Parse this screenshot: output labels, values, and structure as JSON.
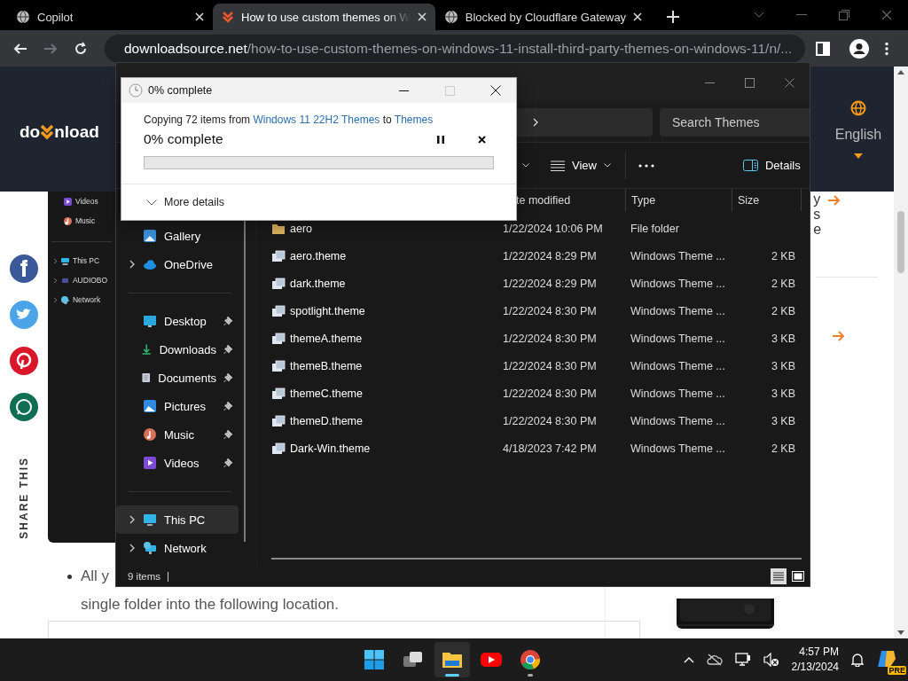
{
  "browser": {
    "tabs": [
      {
        "title": "Copilot",
        "kind": "globe",
        "selected": false
      },
      {
        "title": "How to use custom themes on W",
        "kind": "site",
        "selected": true
      },
      {
        "title": "Blocked by Cloudflare Gateway",
        "kind": "globe",
        "selected": false
      }
    ],
    "nav_buttons": [
      {
        "kind": "back",
        "disabled": false
      },
      {
        "kind": "forward",
        "disabled": true
      },
      {
        "kind": "reload",
        "disabled": false
      }
    ],
    "url": {
      "domain": "downloadsource.net",
      "path": "/how-to-use-custom-themes-on-windows-11-install-third-party-themes-on-windows-11/n/..."
    }
  },
  "page": {
    "logo": {
      "start": "do",
      "end": "nload"
    },
    "language": "English",
    "share_label": "SHARE THIS",
    "share_buttons": [
      {
        "kind": "facebook"
      },
      {
        "kind": "twitter"
      },
      {
        "kind": "pinterest"
      },
      {
        "kind": "whatsapp"
      }
    ],
    "embedded_screenshot": {
      "items": [
        {
          "label": "Videos",
          "kind": "videos",
          "expandable": false
        },
        {
          "label": "Music",
          "kind": "music",
          "expandable": false
        },
        {
          "label": "This PC",
          "kind": "pc",
          "expandable": true
        },
        {
          "label": "AUDIOBO",
          "kind": "drive",
          "expandable": true
        },
        {
          "label": "Network",
          "kind": "network",
          "expandable": true
        }
      ]
    },
    "bullet_lines": [
      "All y",
      "single folder into the following location."
    ],
    "right_fragments": [
      "y",
      "s",
      "e"
    ]
  },
  "explorer": {
    "search_placeholder": "Search Themes",
    "view_label": "View",
    "details_label": "Details",
    "columns": [
      "te modified",
      "Type",
      "Size"
    ],
    "sidebar": [
      {
        "label": "Gallery",
        "kind": "gallery",
        "expandable": false,
        "pinned": false,
        "selected": false
      },
      {
        "label": "OneDrive",
        "kind": "onedrive",
        "expandable": true,
        "pinned": false,
        "selected": false
      },
      {
        "kind": "divider"
      },
      {
        "label": "Desktop",
        "kind": "desktop",
        "expandable": false,
        "pinned": true,
        "selected": false
      },
      {
        "label": "Downloads",
        "kind": "downloads",
        "expandable": false,
        "pinned": true,
        "selected": false
      },
      {
        "label": "Documents",
        "kind": "documents",
        "expandable": false,
        "pinned": true,
        "selected": false
      },
      {
        "label": "Pictures",
        "kind": "pictures",
        "expandable": false,
        "pinned": true,
        "selected": false
      },
      {
        "label": "Music",
        "kind": "music",
        "expandable": false,
        "pinned": true,
        "selected": false
      },
      {
        "label": "Videos",
        "kind": "videos",
        "expandable": false,
        "pinned": true,
        "selected": false
      },
      {
        "kind": "divider"
      },
      {
        "label": "This PC",
        "kind": "pc",
        "expandable": true,
        "pinned": false,
        "selected": true
      },
      {
        "label": "Network",
        "kind": "network",
        "expandable": true,
        "pinned": false,
        "selected": false
      }
    ],
    "rows": [
      {
        "name": "aero",
        "kind": "folder",
        "date": "1/22/2024 10:06 PM",
        "type": "File folder"
      },
      {
        "name": "aero.theme",
        "kind": "theme",
        "date": "1/22/2024 8:29 PM",
        "type": "Windows Theme ...",
        "size": "2 KB"
      },
      {
        "name": "dark.theme",
        "kind": "theme",
        "date": "1/22/2024 8:29 PM",
        "type": "Windows Theme ...",
        "size": "2 KB"
      },
      {
        "name": "spotlight.theme",
        "kind": "theme",
        "date": "1/22/2024 8:30 PM",
        "type": "Windows Theme ...",
        "size": "2 KB"
      },
      {
        "name": "themeA.theme",
        "kind": "theme",
        "date": "1/22/2024 8:30 PM",
        "type": "Windows Theme ...",
        "size": "3 KB"
      },
      {
        "name": "themeB.theme",
        "kind": "theme",
        "date": "1/22/2024 8:30 PM",
        "type": "Windows Theme ...",
        "size": "3 KB"
      },
      {
        "name": "themeC.theme",
        "kind": "theme",
        "date": "1/22/2024 8:30 PM",
        "type": "Windows Theme ...",
        "size": "3 KB"
      },
      {
        "name": "themeD.theme",
        "kind": "theme",
        "date": "1/22/2024 8:30 PM",
        "type": "Windows Theme ...",
        "size": "3 KB"
      },
      {
        "name": "Dark-Win.theme",
        "kind": "theme",
        "date": "4/18/2023 7:42 PM",
        "type": "Windows Theme ...",
        "size": "2 KB"
      }
    ],
    "status": "9 items"
  },
  "dialog": {
    "title": "0% complete",
    "text_start": "Copying 72 items from",
    "source": "Windows 11 22H2 Themes",
    "joiner": "to",
    "destination": "Themes",
    "progress_label": "0% complete",
    "level": 0,
    "more": "More details"
  },
  "taskbar": {
    "apps": [
      {
        "kind": "start",
        "active": false,
        "running": false
      },
      {
        "kind": "taskview",
        "active": false,
        "running": false
      },
      {
        "kind": "explorer",
        "active": true,
        "running": true
      },
      {
        "kind": "youtube",
        "active": false,
        "running": false
      },
      {
        "kind": "chrome",
        "active": false,
        "running": true
      }
    ],
    "time": "4:57 PM",
    "date": "2/13/2024",
    "copilot_badge": "PRE"
  }
}
